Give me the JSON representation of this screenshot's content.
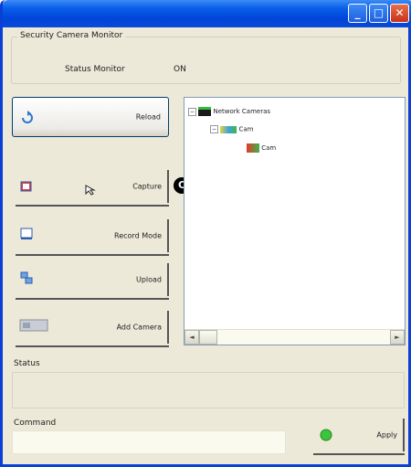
{
  "window": {
    "title": "",
    "buttons": {
      "minimize": "_",
      "maximize": "□",
      "close": "✕"
    }
  },
  "group": {
    "label": "Security Camera Monitor",
    "status_label": "Status Monitor",
    "status_value": "ON"
  },
  "left_buttons": [
    {
      "label": "Reload"
    },
    {
      "label": "Capture"
    },
    {
      "label": "Record Mode"
    },
    {
      "label": "Upload"
    },
    {
      "label": "Add Camera"
    }
  ],
  "tree": {
    "root": "Network Cameras",
    "child": "Cam",
    "leaf": "Cam"
  },
  "status_section": {
    "label": "Status",
    "value": ""
  },
  "command_section": {
    "label": "Command",
    "value": ""
  },
  "action_button": {
    "label": "Apply"
  },
  "marker": {
    "label": "C"
  }
}
